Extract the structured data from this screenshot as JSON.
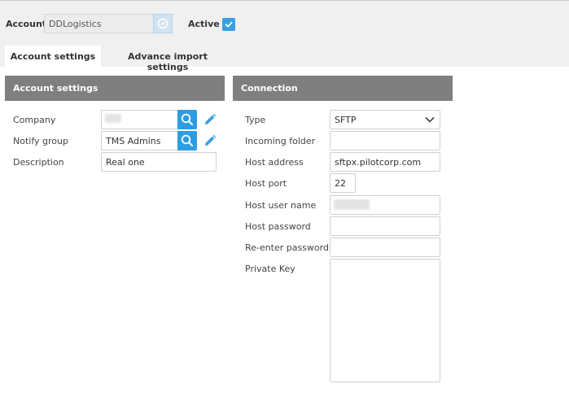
{
  "header": {
    "account_label": "Account",
    "account_value": "DDLogistics",
    "active_label": "Active",
    "active_checked": true
  },
  "tabs": [
    {
      "label": "Account settings",
      "active": true
    },
    {
      "label": "Advance import settings",
      "active": false
    }
  ],
  "account_panel": {
    "title": "Account settings",
    "company_label": "Company",
    "company_value": "",
    "notify_group_label": "Notify group",
    "notify_group_value": "TMS Admins",
    "description_label": "Description",
    "description_value": "Real one"
  },
  "connection_panel": {
    "title": "Connection",
    "type_label": "Type",
    "type_value": "SFTP",
    "incoming_folder_label": "Incoming folder",
    "incoming_folder_value": "",
    "host_address_label": "Host address",
    "host_address_value": "sftpx.pilotcorp.com",
    "host_port_label": "Host port",
    "host_port_value": "22",
    "host_user_label": "Host user name",
    "host_user_value": "",
    "host_password_label": "Host password",
    "host_password_value": "",
    "reenter_password_label": "Re-enter password",
    "reenter_password_value": "",
    "private_key_label": "Private Key",
    "private_key_value": ""
  },
  "colors": {
    "accent": "#2e9ce0",
    "panel_header": "#7f7f7f",
    "topbar": "#f0f0f0"
  }
}
